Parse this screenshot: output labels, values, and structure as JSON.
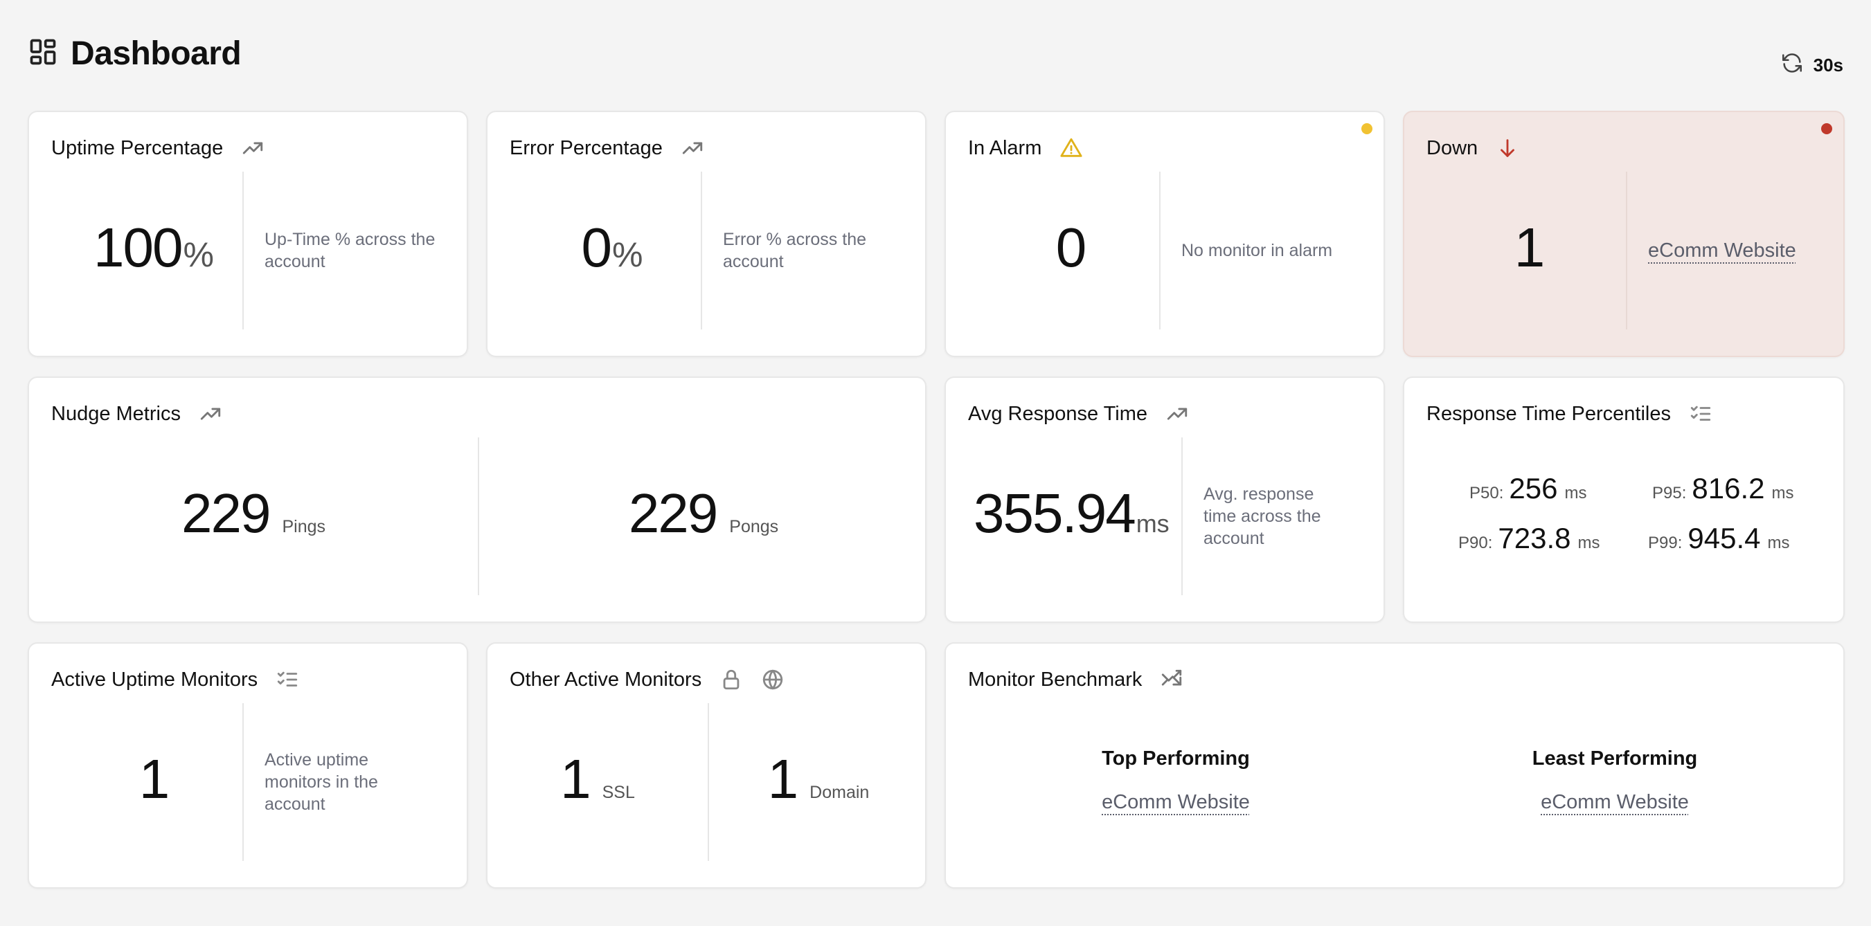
{
  "header": {
    "title": "Dashboard",
    "refresh_label": "30s",
    "title_icon": "dashboard-grid-icon",
    "refresh_icon": "refresh-icon"
  },
  "colors": {
    "accent_warning": "#f1c232",
    "accent_down": "#c0392b",
    "down_card_bg": "#f3e7e4"
  },
  "uptime": {
    "title": "Uptime Percentage",
    "value": "100",
    "unit": "%",
    "desc": "Up-Time % across the account",
    "icon": "trending-up-icon"
  },
  "error": {
    "title": "Error Percentage",
    "value": "0",
    "unit": "%",
    "desc": "Error % across the account",
    "icon": "trending-up-icon"
  },
  "alarm": {
    "title": "In Alarm",
    "value": "0",
    "desc": "No monitor in alarm",
    "icon": "warning-triangle-icon"
  },
  "down": {
    "title": "Down",
    "value": "1",
    "link": "eComm Website",
    "icon": "arrow-down-icon"
  },
  "nudge": {
    "title": "Nudge Metrics",
    "pings_value": "229",
    "pings_label": "Pings",
    "pongs_value": "229",
    "pongs_label": "Pongs",
    "icon": "trending-up-icon"
  },
  "avg_response": {
    "title": "Avg Response Time",
    "value": "355.94",
    "unit": "ms",
    "desc": "Avg. response time across the account",
    "icon": "trending-up-icon"
  },
  "percentiles": {
    "title": "Response Time Percentiles",
    "icon": "checklist-icon",
    "unit": "ms",
    "items": [
      {
        "label": "P50:",
        "value": "256"
      },
      {
        "label": "P95:",
        "value": "816.2"
      },
      {
        "label": "P90:",
        "value": "723.8"
      },
      {
        "label": "P99:",
        "value": "945.4"
      }
    ]
  },
  "active_uptime": {
    "title": "Active Uptime Monitors",
    "value": "1",
    "desc": "Active uptime monitors in the account",
    "icon": "checklist-icon"
  },
  "other_active": {
    "title": "Other Active Monitors",
    "ssl_value": "1",
    "ssl_label": "SSL",
    "domain_value": "1",
    "domain_label": "Domain",
    "icons": [
      "lock-icon",
      "globe-icon"
    ]
  },
  "benchmark": {
    "title": "Monitor Benchmark",
    "icon": "shuffle-icon",
    "top_heading": "Top Performing",
    "top_link": "eComm Website",
    "least_heading": "Least Performing",
    "least_link": "eComm Website"
  }
}
